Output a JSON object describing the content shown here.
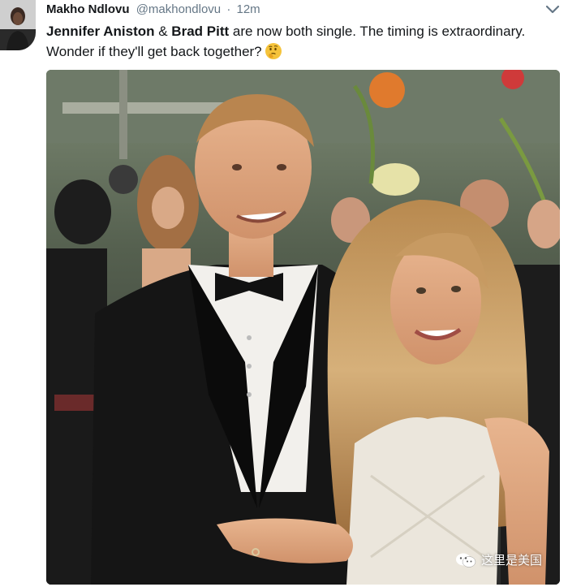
{
  "tweet": {
    "author_name": "Makho Ndlovu",
    "handle": "@makhondlovu",
    "separator": "·",
    "time": "12m",
    "text_part1": "Jennifer Aniston",
    "text_part2": " & ",
    "text_part3": "Brad Pitt",
    "text_part4": " are now both single. The timing is extraordinary. Wonder if they'll get back together?",
    "emoji": "thinking-face-emoji",
    "menu_icon": "chevron-down-icon"
  },
  "watermark": {
    "icon": "wechat-icon",
    "text": "这里是美国"
  },
  "colors": {
    "text": "#14171a",
    "secondary": "#657786"
  }
}
